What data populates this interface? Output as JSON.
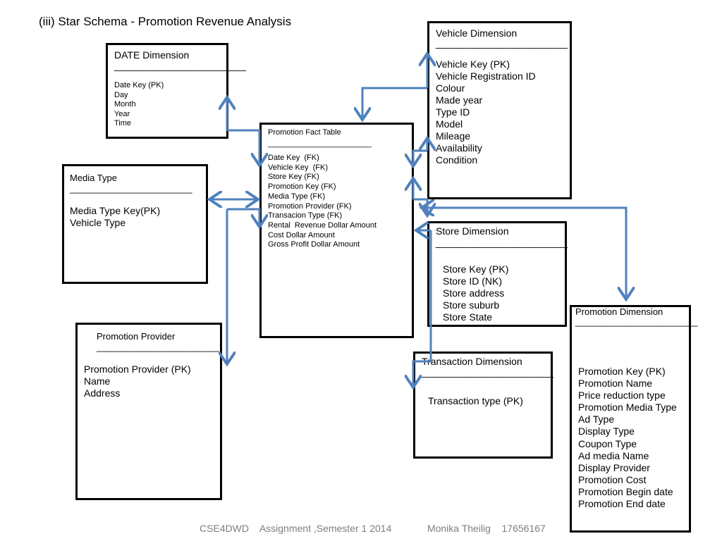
{
  "title": "(iii) Star Schema - Promotion Revenue Analysis",
  "separator": "________________________",
  "arrow_color": "#4f81bd",
  "tables": {
    "date": {
      "name": "DATE Dimension",
      "fields": [
        "Date Key (PK)",
        "Day",
        "Month",
        "Year",
        "Time"
      ]
    },
    "vehicle": {
      "name": "Vehicle Dimension",
      "fields": [
        "Vehicle Key (PK)",
        "Vehicle Registration ID",
        "Colour",
        "Made year",
        "Type ID",
        "Model",
        "Mileage",
        "Availability",
        "Condition"
      ]
    },
    "fact": {
      "name": "Promotion Fact Table",
      "fields": [
        "Date Key  (FK)",
        "Vehicle Key  (FK)",
        "Store Key (FK)",
        "Promotion Key (FK)",
        "Media Type (FK)",
        "Promotion Provider (FK)",
        "Transacion Type (FK)",
        "Rental  Revenue Dollar Amount",
        "Cost Dollar Amount",
        "Gross Profit Dollar Amount"
      ]
    },
    "media": {
      "name": "Media Type",
      "fields": [
        "Media Type Key(PK)",
        "Vehicle Type"
      ]
    },
    "store": {
      "name": "Store Dimension",
      "fields": [
        "Store Key (PK)",
        "Store ID (NK)",
        "Store address",
        "Store suburb",
        "Store State"
      ]
    },
    "promotion": {
      "name": "Promotion Dimension",
      "fields": [
        "Promotion Key (PK)",
        "Promotion Name",
        "Price reduction type",
        "Promotion Media Type",
        "Ad Type",
        "Display Type",
        "Coupon Type",
        "Ad media Name",
        "Display Provider",
        "Promotion Cost",
        "Promotion Begin date",
        "Promotion End date"
      ]
    },
    "provider": {
      "name": "Promotion Provider",
      "fields": [
        "Promotion Provider (PK)",
        "Name",
        "Address"
      ]
    },
    "transaction": {
      "name": "Transaction Dimension",
      "fields": [
        "Transaction type (PK)"
      ]
    }
  },
  "footer": {
    "course": "CSE4DWD",
    "assignment": "Assignment ,Semester 1 2014",
    "author": "Monika Theilig",
    "student_id": "17656167"
  }
}
